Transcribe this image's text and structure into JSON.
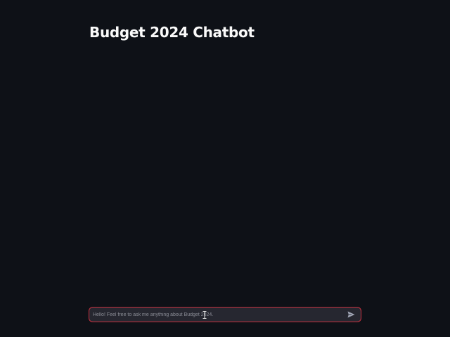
{
  "header": {
    "title": "Budget 2024 Chatbot"
  },
  "chat": {
    "input_placeholder": "Hello! Feel free to ask me anything about Budget 2024.",
    "input_value": "",
    "send_icon": "send-arrow-icon"
  },
  "colors": {
    "background": "#0e1117",
    "input_background": "#262730",
    "input_border_focus": "#c7303f",
    "title": "#fafafa",
    "placeholder": "#8b8d96",
    "send_icon": "#a3a8b8"
  }
}
